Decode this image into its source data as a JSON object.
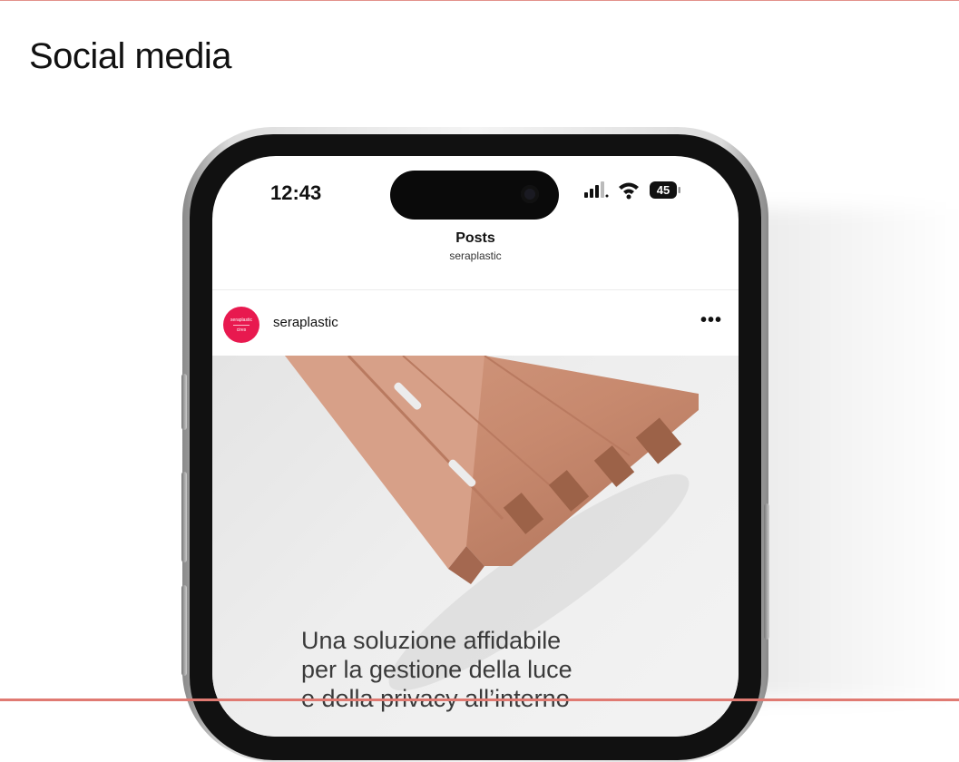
{
  "page": {
    "title": "Social media"
  },
  "status_bar": {
    "time": "12:43",
    "battery": "45"
  },
  "nav": {
    "title": "Posts",
    "subtitle": "seraplastic"
  },
  "post": {
    "username": "seraplastic",
    "avatar_text_top": "seraplastic",
    "avatar_text_bottom": "cires",
    "more_icon": "more-horizontal-icon",
    "caption_lines": [
      "Una soluzione affidabile",
      "per la gestione della luce",
      "e della privacy all’interno"
    ]
  },
  "colors": {
    "brand": "#e8194f",
    "product": "#c98a72",
    "accent_line": "#e07a72"
  }
}
